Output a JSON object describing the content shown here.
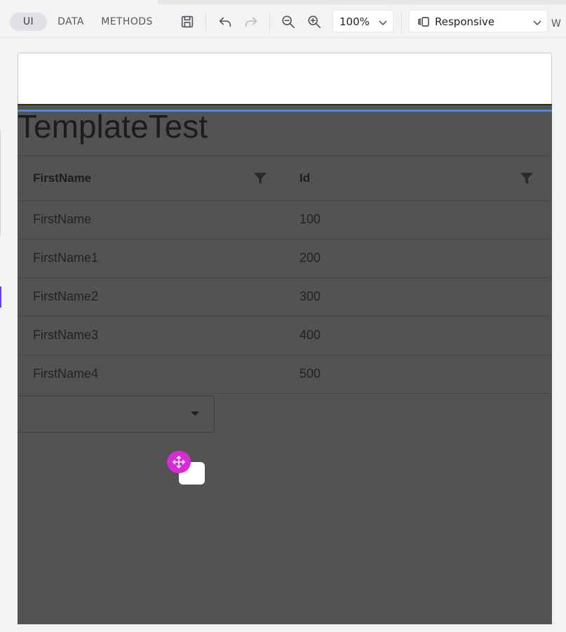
{
  "toolbar": {
    "tabs": [
      {
        "label": "UI",
        "active": true
      },
      {
        "label": "DATA",
        "active": false
      },
      {
        "label": "METHODS",
        "active": false
      }
    ],
    "zoom": {
      "value": "100%"
    },
    "viewport": {
      "value": "Responsive"
    },
    "truncated_label": "W"
  },
  "canvas": {
    "title": "TemplateTest",
    "grid": {
      "columns": [
        "FirstName",
        "Id"
      ],
      "rows": [
        [
          "FirstName",
          "100"
        ],
        [
          "FirstName1",
          "200"
        ],
        [
          "FirstName2",
          "300"
        ],
        [
          "FirstName3",
          "400"
        ],
        [
          "FirstName4",
          "500"
        ]
      ]
    }
  },
  "colors": {
    "active_tab_bg": "#dfe1e6",
    "canvas_overlay": "#535353",
    "selection_line": "#3f8fe0",
    "move_handle": "#d62bd6"
  },
  "icons": [
    "save-icon",
    "undo-icon",
    "redo-icon",
    "zoom-out-icon",
    "zoom-in-icon",
    "chevron-down-icon",
    "responsive-icon",
    "filter-icon",
    "move-icon"
  ]
}
